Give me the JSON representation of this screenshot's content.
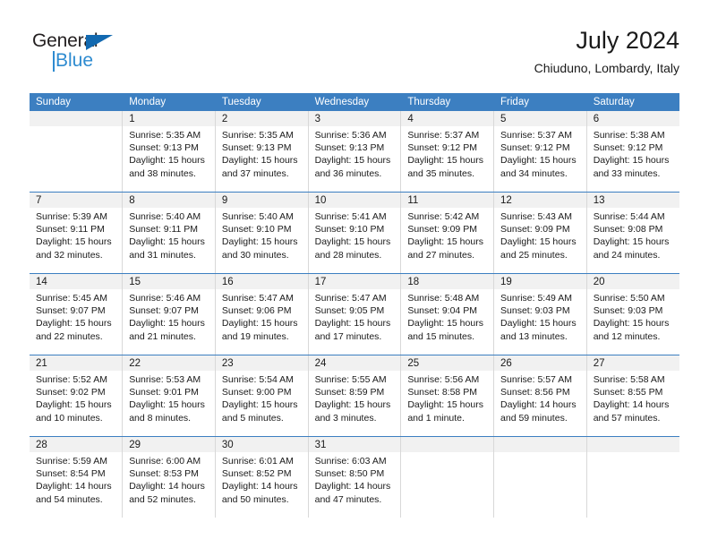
{
  "brand": {
    "name_part1": "General",
    "name_part2": "Blue",
    "triangle_color": "#1269b0",
    "blue_color": "#2e8bd0"
  },
  "header": {
    "title": "July 2024",
    "subtitle": "Chiuduno, Lombardy, Italy"
  },
  "theme": {
    "header_background": "#3c7fc1",
    "header_text": "#ffffff",
    "daynum_background": "#f1f1f1",
    "cell_background": "#ffffff",
    "row_divider": "#3c7fc1",
    "column_divider": "#d8d8d8"
  },
  "weekdays": [
    "Sunday",
    "Monday",
    "Tuesday",
    "Wednesday",
    "Thursday",
    "Friday",
    "Saturday"
  ],
  "weeks": [
    [
      {
        "day": "",
        "empty": true,
        "sunrise": "",
        "sunset": "",
        "daylight_line1": "",
        "daylight_line2": ""
      },
      {
        "day": "1",
        "sunrise": "Sunrise: 5:35 AM",
        "sunset": "Sunset: 9:13 PM",
        "daylight_line1": "Daylight: 15 hours",
        "daylight_line2": "and 38 minutes."
      },
      {
        "day": "2",
        "sunrise": "Sunrise: 5:35 AM",
        "sunset": "Sunset: 9:13 PM",
        "daylight_line1": "Daylight: 15 hours",
        "daylight_line2": "and 37 minutes."
      },
      {
        "day": "3",
        "sunrise": "Sunrise: 5:36 AM",
        "sunset": "Sunset: 9:13 PM",
        "daylight_line1": "Daylight: 15 hours",
        "daylight_line2": "and 36 minutes."
      },
      {
        "day": "4",
        "sunrise": "Sunrise: 5:37 AM",
        "sunset": "Sunset: 9:12 PM",
        "daylight_line1": "Daylight: 15 hours",
        "daylight_line2": "and 35 minutes."
      },
      {
        "day": "5",
        "sunrise": "Sunrise: 5:37 AM",
        "sunset": "Sunset: 9:12 PM",
        "daylight_line1": "Daylight: 15 hours",
        "daylight_line2": "and 34 minutes."
      },
      {
        "day": "6",
        "sunrise": "Sunrise: 5:38 AM",
        "sunset": "Sunset: 9:12 PM",
        "daylight_line1": "Daylight: 15 hours",
        "daylight_line2": "and 33 minutes."
      }
    ],
    [
      {
        "day": "7",
        "sunrise": "Sunrise: 5:39 AM",
        "sunset": "Sunset: 9:11 PM",
        "daylight_line1": "Daylight: 15 hours",
        "daylight_line2": "and 32 minutes."
      },
      {
        "day": "8",
        "sunrise": "Sunrise: 5:40 AM",
        "sunset": "Sunset: 9:11 PM",
        "daylight_line1": "Daylight: 15 hours",
        "daylight_line2": "and 31 minutes."
      },
      {
        "day": "9",
        "sunrise": "Sunrise: 5:40 AM",
        "sunset": "Sunset: 9:10 PM",
        "daylight_line1": "Daylight: 15 hours",
        "daylight_line2": "and 30 minutes."
      },
      {
        "day": "10",
        "sunrise": "Sunrise: 5:41 AM",
        "sunset": "Sunset: 9:10 PM",
        "daylight_line1": "Daylight: 15 hours",
        "daylight_line2": "and 28 minutes."
      },
      {
        "day": "11",
        "sunrise": "Sunrise: 5:42 AM",
        "sunset": "Sunset: 9:09 PM",
        "daylight_line1": "Daylight: 15 hours",
        "daylight_line2": "and 27 minutes."
      },
      {
        "day": "12",
        "sunrise": "Sunrise: 5:43 AM",
        "sunset": "Sunset: 9:09 PM",
        "daylight_line1": "Daylight: 15 hours",
        "daylight_line2": "and 25 minutes."
      },
      {
        "day": "13",
        "sunrise": "Sunrise: 5:44 AM",
        "sunset": "Sunset: 9:08 PM",
        "daylight_line1": "Daylight: 15 hours",
        "daylight_line2": "and 24 minutes."
      }
    ],
    [
      {
        "day": "14",
        "sunrise": "Sunrise: 5:45 AM",
        "sunset": "Sunset: 9:07 PM",
        "daylight_line1": "Daylight: 15 hours",
        "daylight_line2": "and 22 minutes."
      },
      {
        "day": "15",
        "sunrise": "Sunrise: 5:46 AM",
        "sunset": "Sunset: 9:07 PM",
        "daylight_line1": "Daylight: 15 hours",
        "daylight_line2": "and 21 minutes."
      },
      {
        "day": "16",
        "sunrise": "Sunrise: 5:47 AM",
        "sunset": "Sunset: 9:06 PM",
        "daylight_line1": "Daylight: 15 hours",
        "daylight_line2": "and 19 minutes."
      },
      {
        "day": "17",
        "sunrise": "Sunrise: 5:47 AM",
        "sunset": "Sunset: 9:05 PM",
        "daylight_line1": "Daylight: 15 hours",
        "daylight_line2": "and 17 minutes."
      },
      {
        "day": "18",
        "sunrise": "Sunrise: 5:48 AM",
        "sunset": "Sunset: 9:04 PM",
        "daylight_line1": "Daylight: 15 hours",
        "daylight_line2": "and 15 minutes."
      },
      {
        "day": "19",
        "sunrise": "Sunrise: 5:49 AM",
        "sunset": "Sunset: 9:03 PM",
        "daylight_line1": "Daylight: 15 hours",
        "daylight_line2": "and 13 minutes."
      },
      {
        "day": "20",
        "sunrise": "Sunrise: 5:50 AM",
        "sunset": "Sunset: 9:03 PM",
        "daylight_line1": "Daylight: 15 hours",
        "daylight_line2": "and 12 minutes."
      }
    ],
    [
      {
        "day": "21",
        "sunrise": "Sunrise: 5:52 AM",
        "sunset": "Sunset: 9:02 PM",
        "daylight_line1": "Daylight: 15 hours",
        "daylight_line2": "and 10 minutes."
      },
      {
        "day": "22",
        "sunrise": "Sunrise: 5:53 AM",
        "sunset": "Sunset: 9:01 PM",
        "daylight_line1": "Daylight: 15 hours",
        "daylight_line2": "and 8 minutes."
      },
      {
        "day": "23",
        "sunrise": "Sunrise: 5:54 AM",
        "sunset": "Sunset: 9:00 PM",
        "daylight_line1": "Daylight: 15 hours",
        "daylight_line2": "and 5 minutes."
      },
      {
        "day": "24",
        "sunrise": "Sunrise: 5:55 AM",
        "sunset": "Sunset: 8:59 PM",
        "daylight_line1": "Daylight: 15 hours",
        "daylight_line2": "and 3 minutes."
      },
      {
        "day": "25",
        "sunrise": "Sunrise: 5:56 AM",
        "sunset": "Sunset: 8:58 PM",
        "daylight_line1": "Daylight: 15 hours",
        "daylight_line2": "and 1 minute."
      },
      {
        "day": "26",
        "sunrise": "Sunrise: 5:57 AM",
        "sunset": "Sunset: 8:56 PM",
        "daylight_line1": "Daylight: 14 hours",
        "daylight_line2": "and 59 minutes."
      },
      {
        "day": "27",
        "sunrise": "Sunrise: 5:58 AM",
        "sunset": "Sunset: 8:55 PM",
        "daylight_line1": "Daylight: 14 hours",
        "daylight_line2": "and 57 minutes."
      }
    ],
    [
      {
        "day": "28",
        "sunrise": "Sunrise: 5:59 AM",
        "sunset": "Sunset: 8:54 PM",
        "daylight_line1": "Daylight: 14 hours",
        "daylight_line2": "and 54 minutes."
      },
      {
        "day": "29",
        "sunrise": "Sunrise: 6:00 AM",
        "sunset": "Sunset: 8:53 PM",
        "daylight_line1": "Daylight: 14 hours",
        "daylight_line2": "and 52 minutes."
      },
      {
        "day": "30",
        "sunrise": "Sunrise: 6:01 AM",
        "sunset": "Sunset: 8:52 PM",
        "daylight_line1": "Daylight: 14 hours",
        "daylight_line2": "and 50 minutes."
      },
      {
        "day": "31",
        "sunrise": "Sunrise: 6:03 AM",
        "sunset": "Sunset: 8:50 PM",
        "daylight_line1": "Daylight: 14 hours",
        "daylight_line2": "and 47 minutes."
      },
      {
        "day": "",
        "empty": true,
        "sunrise": "",
        "sunset": "",
        "daylight_line1": "",
        "daylight_line2": ""
      },
      {
        "day": "",
        "empty": true,
        "sunrise": "",
        "sunset": "",
        "daylight_line1": "",
        "daylight_line2": ""
      },
      {
        "day": "",
        "empty": true,
        "sunrise": "",
        "sunset": "",
        "daylight_line1": "",
        "daylight_line2": ""
      }
    ]
  ]
}
